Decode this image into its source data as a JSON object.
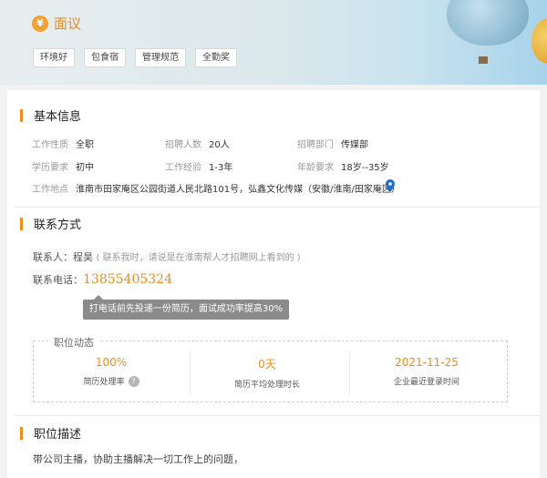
{
  "header": {
    "salary_icon": "¥",
    "salary": "面议",
    "tags": [
      "环境好",
      "包食宿",
      "管理规范",
      "全勤奖"
    ]
  },
  "basic": {
    "title": "基本信息",
    "rows": [
      [
        {
          "label": "工作性质",
          "value": "全职"
        },
        {
          "label": "招聘人数",
          "value": "20人"
        },
        {
          "label": "招聘部门",
          "value": "传媒部"
        }
      ],
      [
        {
          "label": "学历要求",
          "value": "初中"
        },
        {
          "label": "工作经验",
          "value": "1-3年"
        },
        {
          "label": "年龄要求",
          "value": "18岁--35岁"
        }
      ]
    ],
    "location_label": "工作地点",
    "location": "淮南市田家庵区公园街道人民北路101号，弘鑫文化传媒（安徽/淮南/田家庵区）"
  },
  "contact": {
    "title": "联系方式",
    "person_label": "联系人：",
    "person": "程昊",
    "person_hint": "( 联系我时，请说是在淮南帮人才招聘网上看到的 )",
    "phone_label": "联系电话：",
    "phone": "13855405324",
    "tooltip": "打电话前先投递一份简历，面试成功率提高30%"
  },
  "stats": {
    "label": "职位动态",
    "items": [
      {
        "value": "100%",
        "caption": "简历处理率",
        "help": "?"
      },
      {
        "value": "0天",
        "caption": "简历平均处理时长"
      },
      {
        "value": "2021-11-25",
        "caption": "企业最近登录时间"
      }
    ]
  },
  "description": {
    "title": "职位描述",
    "text": "带公司主播，协助主播解决一切工作上的问题，"
  },
  "colors": {
    "accent": "#f08a18",
    "tag_border": "#d8d8d8",
    "location_pin": "#1a6fd0"
  }
}
